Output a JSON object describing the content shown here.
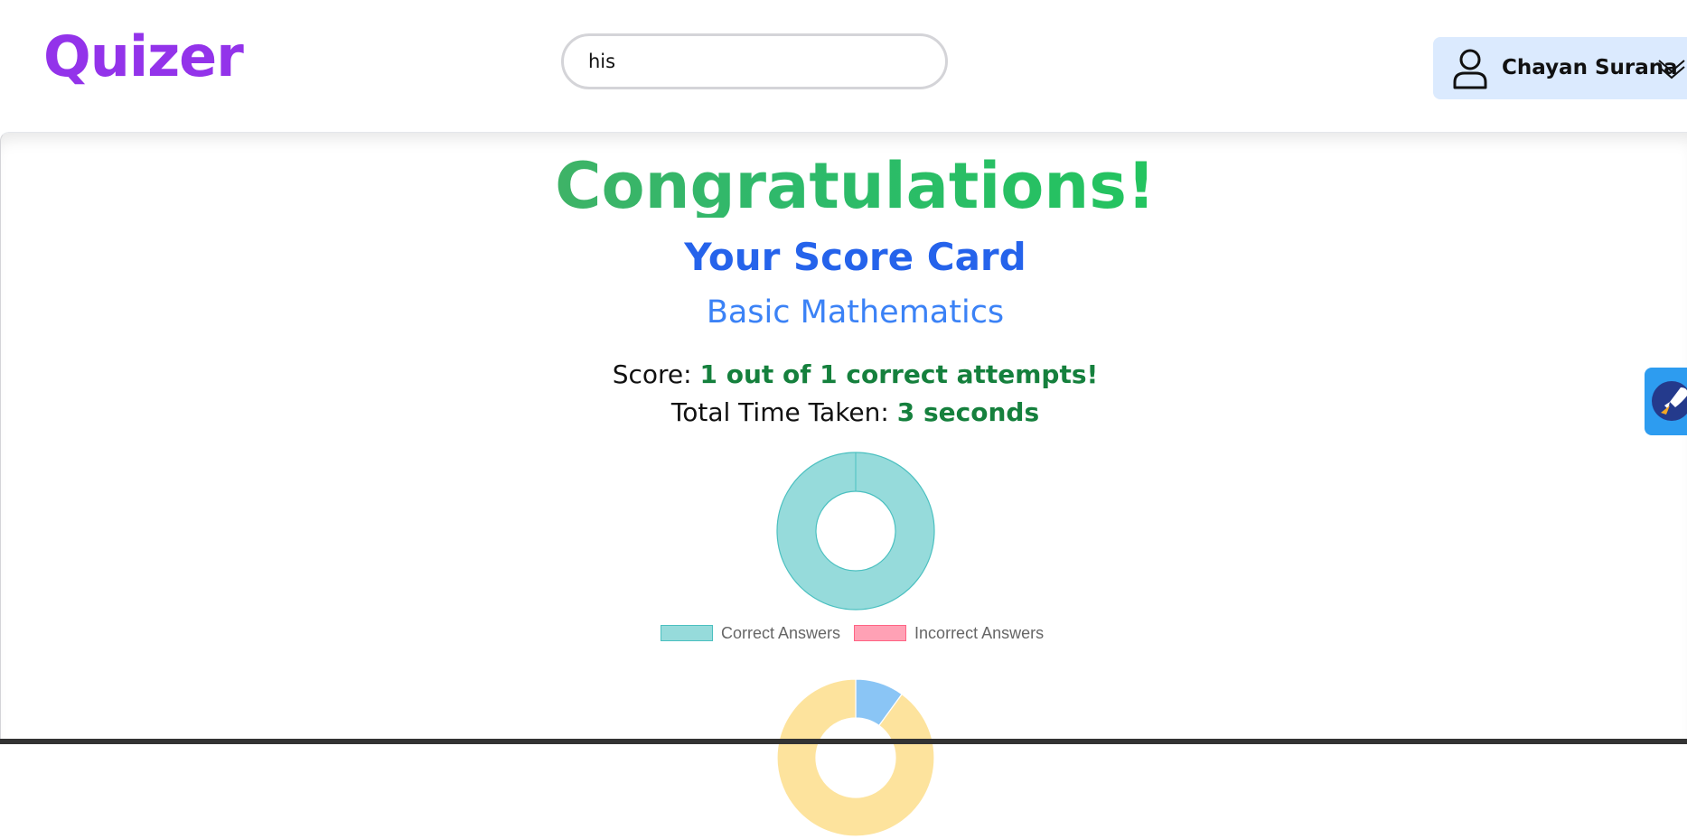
{
  "header": {
    "logo": "Quizer",
    "search": {
      "value": "his",
      "placeholder": ""
    },
    "user": {
      "name": "Chayan Surana"
    }
  },
  "results": {
    "title": "Congratulations!",
    "heading": "Your Score Card",
    "subject": "Basic Mathematics",
    "score_label": "Score: ",
    "score_value": "1 out of 1 correct attempts!",
    "time_label": "Total Time Taken: ",
    "time_value": "3 seconds"
  },
  "chart_data": [
    {
      "type": "pie",
      "variant": "doughnut",
      "categories": [
        "Correct Answers",
        "Incorrect Answers"
      ],
      "values": [
        1,
        0
      ],
      "colors": [
        "#96dbdb",
        "#ffa1b5"
      ],
      "border_colors": [
        "#4bc0c0",
        "#ff6384"
      ],
      "legend": "bottom"
    },
    {
      "type": "pie",
      "variant": "doughnut",
      "partially_visible": true,
      "slices_visible": [
        {
          "value": 0.1,
          "color": "#8ac5f5"
        },
        {
          "value": 0.9,
          "color": "#fde39d"
        }
      ]
    }
  ],
  "colors": {
    "brand": "#9333ea",
    "heading": "#2563eb",
    "subject": "#3b82f6",
    "value_green": "#15803d",
    "user_menu_bg": "#dbeafe",
    "fab_bg": "#2d9cf0"
  },
  "icons": {
    "user": "user-outline-icon",
    "chevron": "double-chevron-down-icon",
    "fab": "rocket-icon"
  }
}
